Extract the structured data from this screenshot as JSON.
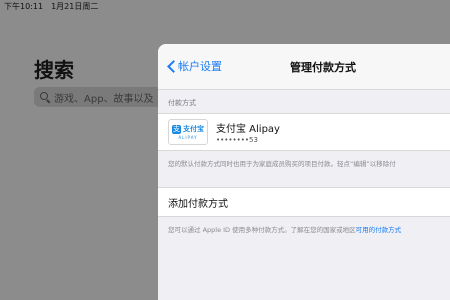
{
  "status_bar": {
    "time": "下午10:11",
    "date": "1月21日周二"
  },
  "background": {
    "title": "搜索",
    "search_placeholder": "游戏、App、故事以及"
  },
  "sheet": {
    "back_label": "帐户设置",
    "title": "管理付款方式",
    "section_header": "付款方式",
    "payment": {
      "icon_text_cn": "支付宝",
      "icon_text_en": "ALIPAY",
      "icon_mark": "支",
      "name": "支付宝 Alipay",
      "masked_number": "••••••••53"
    },
    "note1": "您的默认付款方式同时也用于为家庭成员购买的项目付款。轻点“编辑”以移除付",
    "add_label": "添加付款方式",
    "note2_prefix": "您可以通过 Apple ID 使用多种付款方式。了解在您的国家或地区",
    "note2_link": "可用的付款方式"
  }
}
